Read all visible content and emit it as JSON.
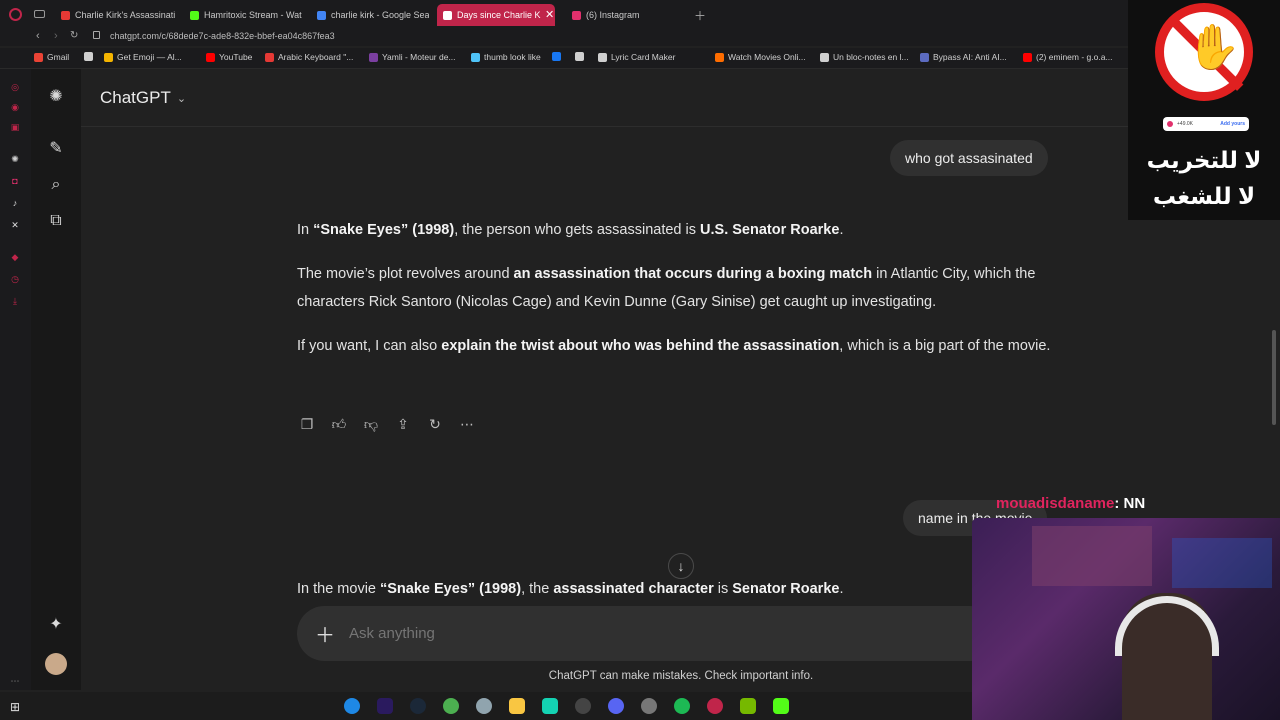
{
  "browser": {
    "tabs": [
      {
        "label": "Charlie Kirk's Assassinati",
        "color": "#e53935"
      },
      {
        "label": "Hamritoxic Stream - Watc",
        "color": "#53fc18"
      },
      {
        "label": "charlie kirk - Google Sear",
        "color": "#4285f4"
      },
      {
        "label": "Days since Charlie K",
        "color": "#ffffff",
        "active": true
      },
      {
        "label": "(6) Instagram",
        "color": "#e1306c"
      }
    ],
    "url": "chatgpt.com/c/68dede7c-ade8-832e-bbef-ea04c867fea3",
    "bookmarks": [
      {
        "label": "Gmail",
        "color": "#ea4335"
      },
      {
        "label": "",
        "color": "#cfcfcf"
      },
      {
        "label": "Get Emoji — Al...",
        "color": "#f4b400"
      },
      {
        "label": "YouTube",
        "color": "#ff0000"
      },
      {
        "label": "Arabic Keyboard \"...",
        "color": "#e53935"
      },
      {
        "label": "Yamli - Moteur de...",
        "color": "#7b3fa0"
      },
      {
        "label": "thumb look like",
        "color": "#4fc3f7"
      },
      {
        "label": "",
        "color": "#1877f2"
      },
      {
        "label": "",
        "color": "#cfcfcf"
      },
      {
        "label": "Lyric Card Maker",
        "color": "#cfcfcf"
      },
      {
        "label": "Watch Movies Onli...",
        "color": "#ff6d00"
      },
      {
        "label": "Un bloc-notes en l...",
        "color": "#cfcfcf"
      },
      {
        "label": "Bypass AI: Anti AI...",
        "color": "#5c6bc0"
      },
      {
        "label": "(2) eminem - g.o.a...",
        "color": "#ff0000"
      }
    ]
  },
  "app": {
    "name": "ChatGPT",
    "sidebar_icons": [
      "chatgpt-logo-icon",
      "new-chat-icon",
      "search-icon",
      "library-icon",
      "sparkle-icon",
      "avatar"
    ]
  },
  "conversation": {
    "user_msg_1": "who got assasinated",
    "answer_1": {
      "p1": [
        {
          "t": "In "
        },
        {
          "t": "“Snake Eyes” (1998)",
          "b": true
        },
        {
          "t": ", the person who gets assassinated is "
        },
        {
          "t": "U.S. Senator Roarke",
          "b": true
        },
        {
          "t": "."
        }
      ],
      "p2": [
        {
          "t": "The movie’s plot revolves around "
        },
        {
          "t": "an assassination that occurs during a boxing match",
          "b": true
        },
        {
          "t": " in Atlantic City, which the characters Rick Santoro (Nicolas Cage) and Kevin Dunne (Gary Sinise) get caught up investigating."
        }
      ],
      "p3": [
        {
          "t": "If you want, I can also "
        },
        {
          "t": "explain the twist about who was behind the assassination",
          "b": true
        },
        {
          "t": ", which is a big part of the movie."
        }
      ]
    },
    "user_msg_2": "name in the movie",
    "answer_2": [
      {
        "t": "In the movie "
      },
      {
        "t": "“Snake Eyes” (1998)",
        "b": true
      },
      {
        "t": ", the "
      },
      {
        "t": "assassinated character",
        "b": true
      },
      {
        "t": " is "
      },
      {
        "t": "Senator Roarke",
        "b": true
      },
      {
        "t": "."
      }
    ]
  },
  "composer": {
    "placeholder": "Ask anything"
  },
  "disclaimer": "ChatGPT can make mistakes. Check important info.",
  "overlay": {
    "chat_user": "mouadisdaname",
    "chat_text": ": NN",
    "chat_user_color": "#e0245e",
    "arabic_line_1": "لا للتخريب",
    "arabic_line_2": "لا للشغب",
    "badge_count": "+49.0K",
    "badge_label": "Add yours"
  }
}
